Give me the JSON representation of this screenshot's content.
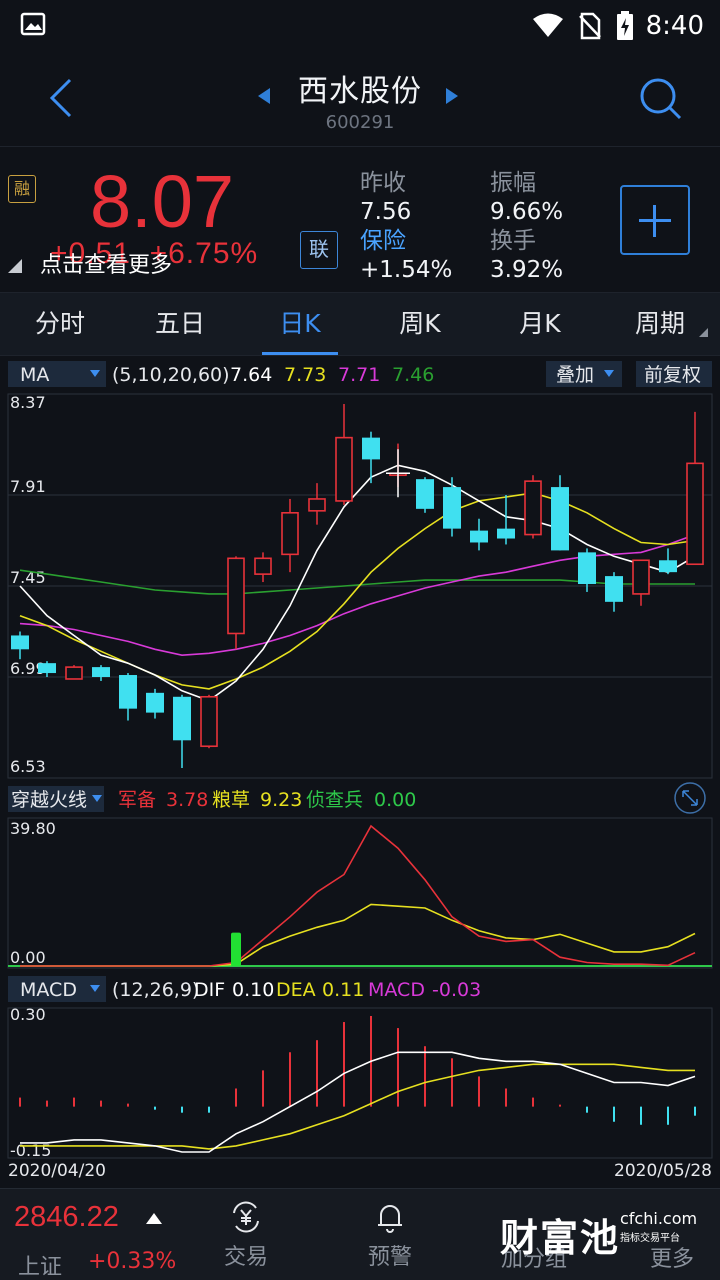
{
  "status_bar": {
    "time": "8:40"
  },
  "header": {
    "title": "西水股份",
    "code": "600291"
  },
  "quote": {
    "rong_badge": "融",
    "price": "8.07",
    "change": "+0.51",
    "change_pct": "+6.75%",
    "more_tip": "点击查看更多",
    "lian_badge": "联",
    "stats": {
      "prev_close_label": "昨收",
      "prev_close": "7.56",
      "amplitude_label": "振幅",
      "amplitude": "9.66%",
      "insurance_label": "保险",
      "insurance": "+1.54%",
      "turnover_label": "换手",
      "turnover": "3.92%"
    }
  },
  "tabs": [
    "分时",
    "五日",
    "日K",
    "周K",
    "月K",
    "周期"
  ],
  "active_tab": 2,
  "colors": {
    "up": "#e8323a",
    "down": "#40e0f0",
    "ma5": "#ffffff",
    "ma10": "#e6e020",
    "ma20": "#d83ad8",
    "ma60": "#2aa030",
    "accent": "#3d8ef0"
  },
  "chart_data": [
    {
      "type": "candlestick",
      "indicator_label": "MA",
      "params": "(5,10,20,60)",
      "ma_values": [
        "7.64",
        "7.73",
        "7.71",
        "7.46"
      ],
      "overlay_button": "叠加",
      "adjust_button": "前复权",
      "y_ticks": [
        "8.37",
        "7.91",
        "7.45",
        "6.99",
        "6.53"
      ],
      "ylim": [
        6.53,
        8.37
      ],
      "candles": [
        {
          "o": 7.2,
          "c": 7.13,
          "h": 7.22,
          "l": 7.08
        },
        {
          "o": 7.06,
          "c": 7.01,
          "h": 7.07,
          "l": 6.99
        },
        {
          "o": 6.98,
          "c": 7.04,
          "h": 7.05,
          "l": 6.98
        },
        {
          "o": 7.04,
          "c": 6.99,
          "h": 7.05,
          "l": 6.97
        },
        {
          "o": 7.0,
          "c": 6.83,
          "h": 7.01,
          "l": 6.77
        },
        {
          "o": 6.91,
          "c": 6.81,
          "h": 6.93,
          "l": 6.78
        },
        {
          "o": 6.89,
          "c": 6.67,
          "h": 6.9,
          "l": 6.53
        },
        {
          "o": 6.64,
          "c": 6.89,
          "h": 6.9,
          "l": 6.63
        },
        {
          "o": 7.21,
          "c": 7.59,
          "h": 7.6,
          "l": 7.13
        },
        {
          "o": 7.51,
          "c": 7.59,
          "h": 7.62,
          "l": 7.47
        },
        {
          "o": 7.61,
          "c": 7.82,
          "h": 7.89,
          "l": 7.52
        },
        {
          "o": 7.83,
          "c": 7.89,
          "h": 7.97,
          "l": 7.76
        },
        {
          "o": 7.88,
          "c": 8.2,
          "h": 8.37,
          "l": 7.86
        },
        {
          "o": 8.2,
          "c": 8.09,
          "h": 8.23,
          "l": 7.97
        },
        {
          "o": 8.02,
          "c": 8.02,
          "h": 8.17,
          "l": 7.95
        },
        {
          "o": 7.99,
          "c": 7.84,
          "h": 8.0,
          "l": 7.82
        },
        {
          "o": 7.95,
          "c": 7.74,
          "h": 8.0,
          "l": 7.7
        },
        {
          "o": 7.73,
          "c": 7.67,
          "h": 7.79,
          "l": 7.63
        },
        {
          "o": 7.74,
          "c": 7.69,
          "h": 7.91,
          "l": 7.66
        },
        {
          "o": 7.71,
          "c": 7.98,
          "h": 8.01,
          "l": 7.69
        },
        {
          "o": 7.95,
          "c": 7.63,
          "h": 8.01,
          "l": 7.63
        },
        {
          "o": 7.62,
          "c": 7.46,
          "h": 7.64,
          "l": 7.42
        },
        {
          "o": 7.5,
          "c": 7.37,
          "h": 7.52,
          "l": 7.32
        },
        {
          "o": 7.41,
          "c": 7.58,
          "h": 7.58,
          "l": 7.35
        },
        {
          "o": 7.58,
          "c": 7.52,
          "h": 7.64,
          "l": 7.51
        },
        {
          "o": 7.56,
          "c": 8.07,
          "h": 8.33,
          "l": 7.56
        }
      ],
      "ma5": [
        7.45,
        7.3,
        7.2,
        7.1,
        7.06,
        7.0,
        6.92,
        6.87,
        6.97,
        7.13,
        7.35,
        7.63,
        7.85,
        8.0,
        8.06,
        8.03,
        7.96,
        7.88,
        7.8,
        7.78,
        7.74,
        7.66,
        7.6,
        7.56,
        7.52,
        7.6
      ],
      "ma10": [
        7.3,
        7.25,
        7.18,
        7.12,
        7.06,
        7.0,
        6.95,
        6.93,
        6.98,
        7.04,
        7.12,
        7.22,
        7.36,
        7.52,
        7.64,
        7.74,
        7.83,
        7.88,
        7.9,
        7.92,
        7.88,
        7.82,
        7.74,
        7.67,
        7.66,
        7.68
      ],
      "ma20": [
        7.26,
        7.25,
        7.23,
        7.2,
        7.17,
        7.13,
        7.1,
        7.11,
        7.13,
        7.16,
        7.2,
        7.25,
        7.31,
        7.36,
        7.4,
        7.44,
        7.47,
        7.5,
        7.52,
        7.55,
        7.58,
        7.6,
        7.61,
        7.62,
        7.66,
        7.71
      ],
      "ma60": [
        7.53,
        7.51,
        7.49,
        7.47,
        7.45,
        7.43,
        7.42,
        7.41,
        7.41,
        7.42,
        7.43,
        7.44,
        7.45,
        7.46,
        7.47,
        7.48,
        7.48,
        7.48,
        7.48,
        7.48,
        7.48,
        7.47,
        7.46,
        7.46,
        7.46,
        7.46
      ],
      "crosshair_index": 14
    },
    {
      "type": "line",
      "indicator_label": "穿越火线",
      "series_labels": [
        {
          "name": "军备",
          "value": "3.78"
        },
        {
          "name": "粮草",
          "value": "9.23"
        },
        {
          "name": "侦查兵",
          "value": "0.00"
        }
      ],
      "y_ticks": [
        "39.80",
        "0.00"
      ],
      "ylim": [
        0,
        39.8
      ],
      "junbei": [
        0,
        0,
        0,
        0,
        0,
        0,
        0,
        0,
        1.0,
        7.5,
        14.0,
        21.0,
        26.0,
        39.8,
        33.5,
        24.5,
        14.0,
        8.5,
        7.0,
        7.5,
        2.5,
        1.0,
        0.5,
        0.5,
        0.2,
        3.78
      ],
      "liangcao": [
        0,
        0,
        0,
        0,
        0,
        0,
        0,
        0,
        0.5,
        5.5,
        8.5,
        11.0,
        13.0,
        17.5,
        17.0,
        16.5,
        13.0,
        10.0,
        8.0,
        7.5,
        9.0,
        6.5,
        4.0,
        4.0,
        5.5,
        9.23
      ],
      "signal_bar_index": 8
    },
    {
      "type": "macd",
      "indicator_label": "MACD",
      "params": "(12,26,9)",
      "dif_label": "DIF",
      "dif_value": "0.10",
      "dea_label": "DEA",
      "dea_value": "0.11",
      "macd_label": "MACD",
      "macd_value": "-0.03",
      "y_ticks": [
        "0.30",
        "-0.15"
      ],
      "ylim": [
        -0.17,
        0.3
      ],
      "dif": [
        -0.12,
        -0.12,
        -0.11,
        -0.11,
        -0.12,
        -0.13,
        -0.15,
        -0.15,
        -0.09,
        -0.05,
        0.0,
        0.05,
        0.11,
        0.15,
        0.18,
        0.18,
        0.18,
        0.16,
        0.15,
        0.15,
        0.14,
        0.11,
        0.08,
        0.08,
        0.07,
        0.1
      ],
      "dea": [
        -0.13,
        -0.13,
        -0.13,
        -0.13,
        -0.13,
        -0.13,
        -0.13,
        -0.14,
        -0.13,
        -0.11,
        -0.09,
        -0.06,
        -0.03,
        0.01,
        0.05,
        0.08,
        0.1,
        0.12,
        0.13,
        0.14,
        0.14,
        0.14,
        0.14,
        0.13,
        0.12,
        0.12
      ],
      "macd": [
        0.03,
        0.02,
        0.03,
        0.02,
        0.01,
        -0.01,
        -0.02,
        -0.02,
        0.06,
        0.12,
        0.18,
        0.22,
        0.28,
        0.3,
        0.26,
        0.2,
        0.16,
        0.1,
        0.06,
        0.03,
        0.0,
        -0.02,
        -0.05,
        -0.06,
        -0.06,
        -0.03
      ],
      "date_start": "2020/04/20",
      "date_end": "2020/05/28"
    }
  ],
  "bottom_bar": {
    "index_value": "2846.22",
    "index_name": "上证",
    "index_pct": "+0.33%",
    "nav": [
      {
        "label": "交易",
        "icon": "yuan-exchange-icon"
      },
      {
        "label": "预警",
        "icon": "bell-icon"
      },
      {
        "label": "加分组",
        "icon": "group-icon"
      },
      {
        "label": "更多",
        "icon": "more-icon"
      }
    ],
    "watermark": {
      "name": "财富池",
      "site": "cfchi.com",
      "tagline": "指标交易平台"
    }
  }
}
